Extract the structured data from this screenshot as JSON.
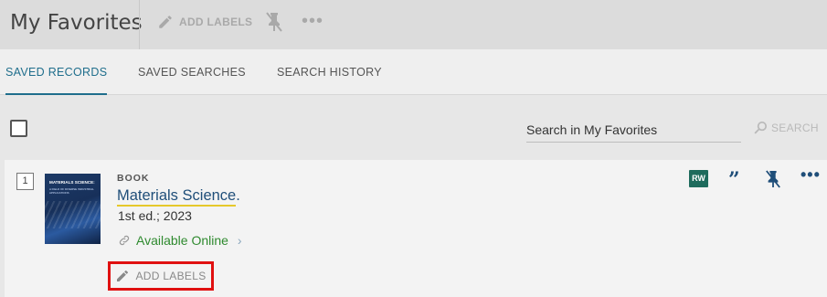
{
  "header": {
    "title": "My Favorites",
    "add_labels": "ADD LABELS",
    "unpin_icon": "unpin-icon",
    "more_icon": "more-horizontal-icon"
  },
  "tabs": [
    {
      "label": "SAVED RECORDS",
      "active": true
    },
    {
      "label": "SAVED SEARCHES",
      "active": false
    },
    {
      "label": "SEARCH HISTORY",
      "active": false
    }
  ],
  "toolbar": {
    "search_placeholder": "Search in My Favorites",
    "search_button": "SEARCH"
  },
  "records": [
    {
      "index": "1",
      "type": "BOOK",
      "title": "Materials Science",
      "title_suffix": ".",
      "edition": "1st ed.; 2023",
      "availability": "Available Online",
      "add_labels": "ADD LABELS",
      "cover": {
        "title": "MATERIALS SCIENCE:",
        "subtitle": "A FIELD OF DIVERSE INDUSTRIAL APPLICATIONS"
      },
      "actions": {
        "rw_badge": "RW"
      }
    }
  ],
  "colors": {
    "accent": "#1f6e8c",
    "title_link": "#1f4e79",
    "available": "#2f8a2f",
    "highlight_box": "#e01010",
    "title_underline": "#e6c82b",
    "rw_badge": "#1e6b5c"
  }
}
